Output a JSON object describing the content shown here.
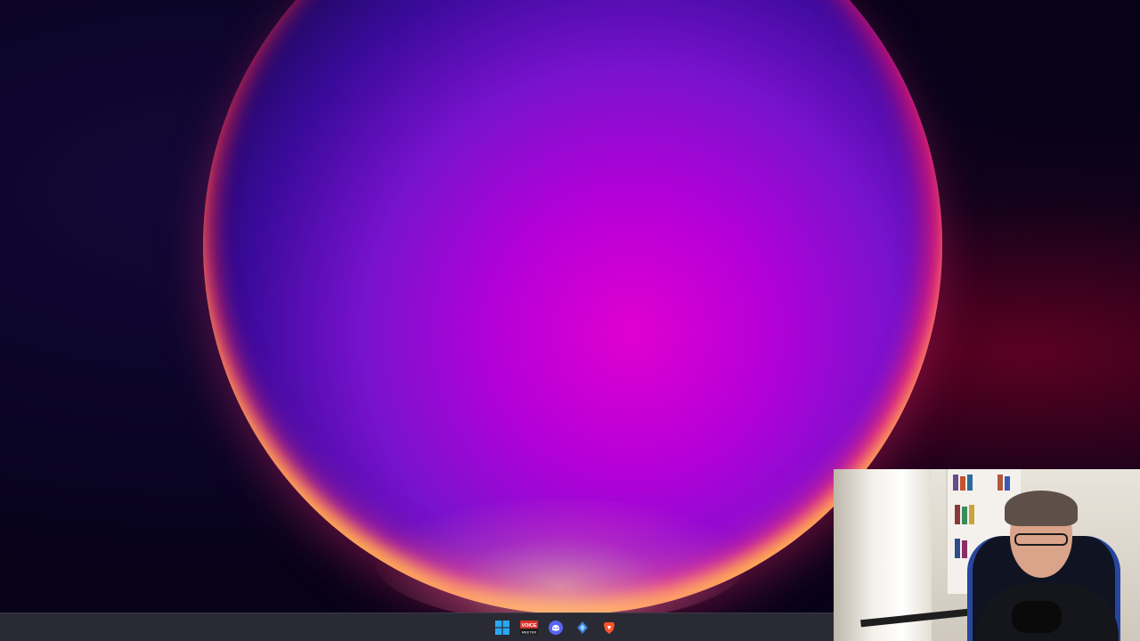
{
  "desktop": {
    "wallpaper": "purple-orb-bloom",
    "colors": {
      "background": "#0c0428",
      "orb_core": "#e000d0",
      "orb_edge": "#ff2a6a",
      "glow": "#ffd27a"
    }
  },
  "taskbar": {
    "background": "#2a2a34",
    "items": [
      {
        "name": "start",
        "icon": "windows-logo-icon"
      },
      {
        "name": "voicemeeter",
        "icon": "voicemeeter-icon",
        "label_top": "VOICE",
        "label_bottom": "MEETER"
      },
      {
        "name": "discord",
        "icon": "discord-icon"
      },
      {
        "name": "app",
        "icon": "diamond-app-icon"
      },
      {
        "name": "brave",
        "icon": "brave-lion-icon"
      }
    ]
  },
  "webcam": {
    "description_icon": "webcam-overlay"
  }
}
